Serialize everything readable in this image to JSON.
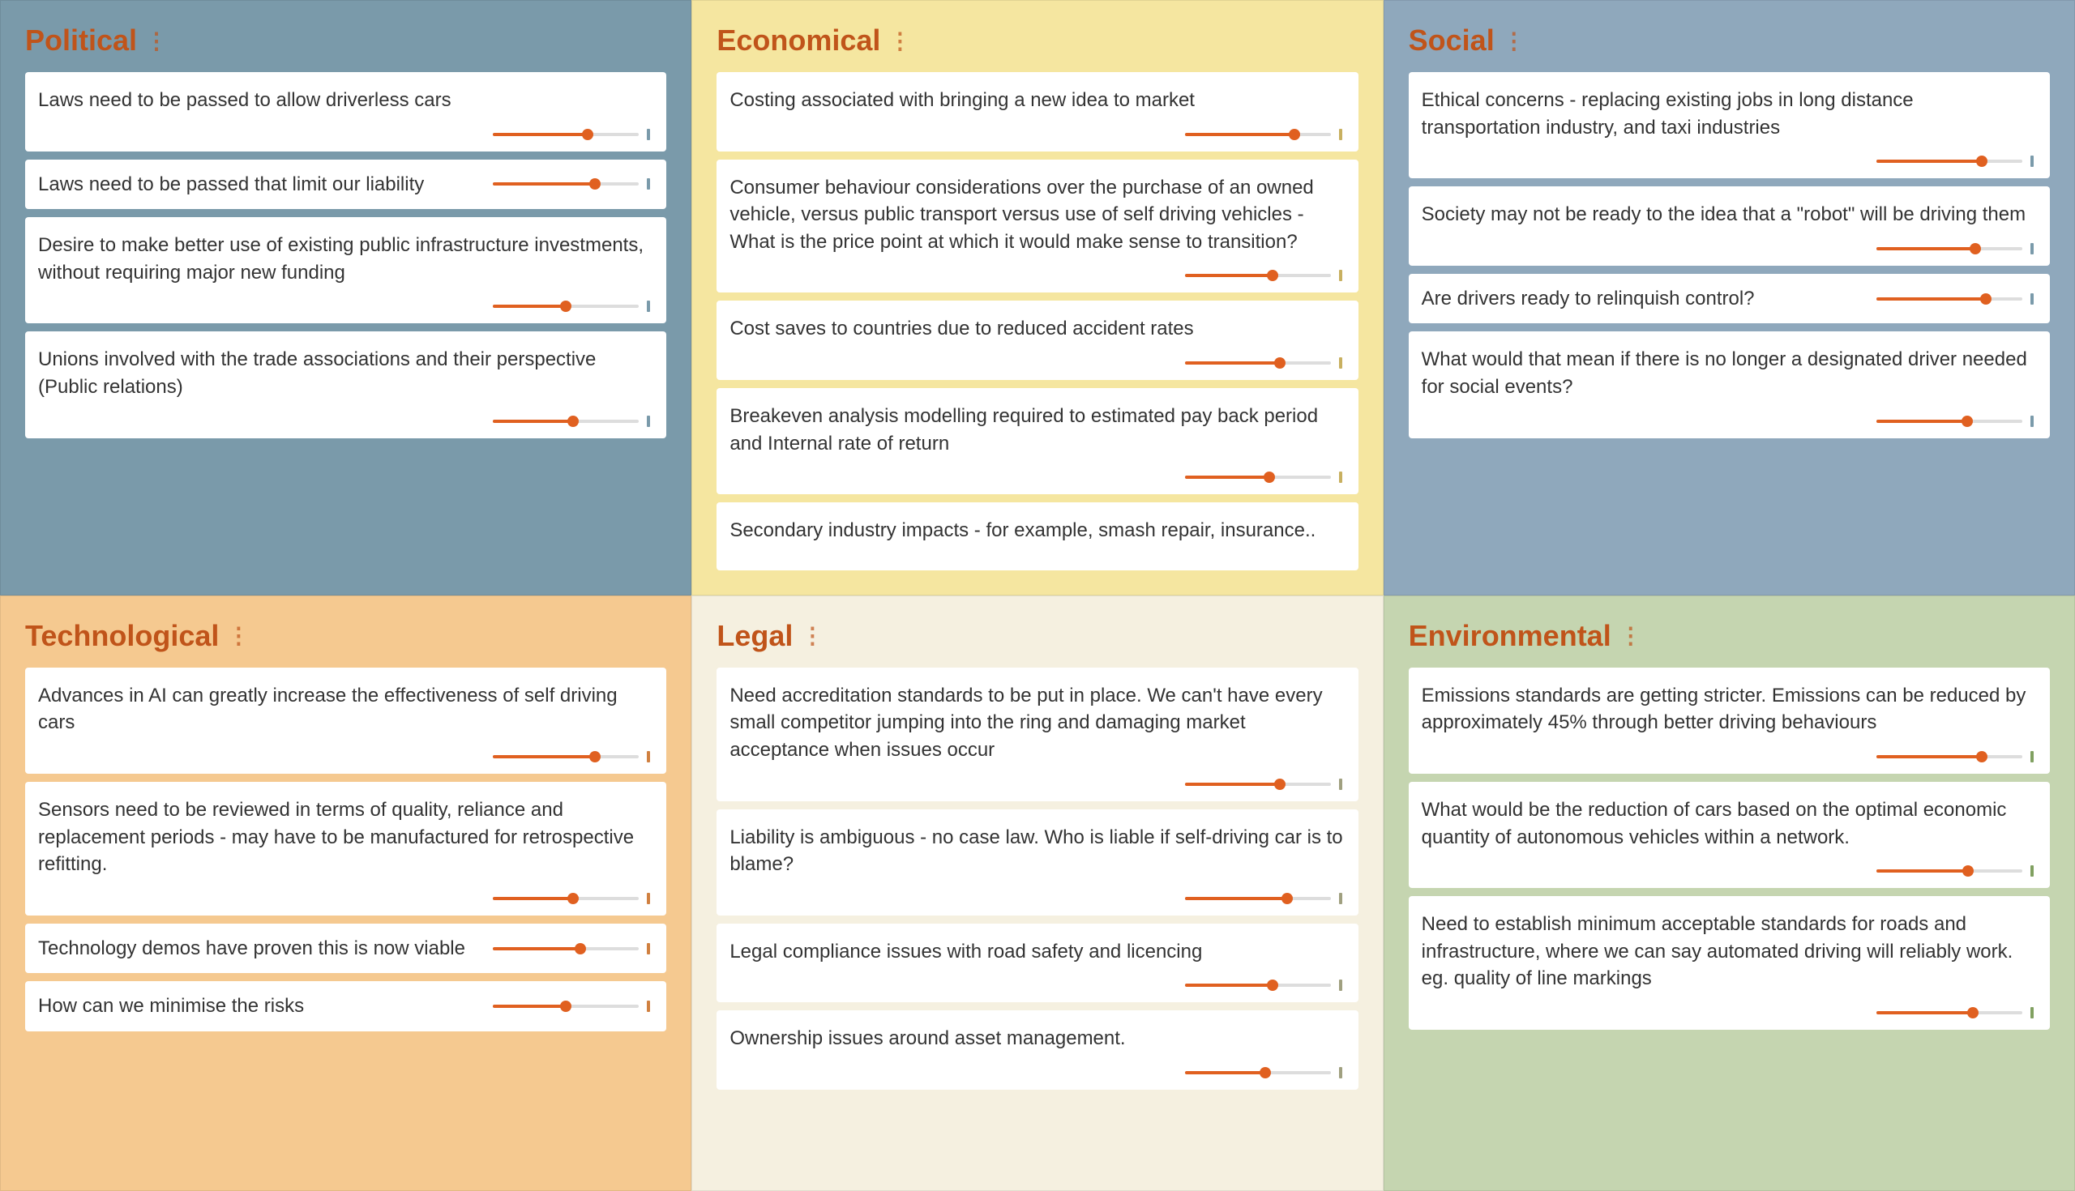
{
  "sections": [
    {
      "id": "political",
      "title": "Political",
      "colorClass": "section-political",
      "cards": [
        {
          "text": "Laws need to be passed to allow driverless cars",
          "sliderFill": 65,
          "inline": false
        },
        {
          "text": "Laws need to be passed that limit our liability",
          "sliderFill": 70,
          "inline": true
        },
        {
          "text": "Desire to make better use of existing public infrastructure investments, without requiring major new funding",
          "sliderFill": 50,
          "inline": false
        },
        {
          "text": "Unions involved with the trade associations and their perspective (Public relations)",
          "sliderFill": 55,
          "inline": false
        }
      ]
    },
    {
      "id": "economical",
      "title": "Economical",
      "colorClass": "section-economical",
      "cards": [
        {
          "text": "Costing associated with bringing a new idea to market",
          "sliderFill": 75,
          "inline": false
        },
        {
          "text": "Consumer behaviour considerations over the purchase of an owned vehicle, versus public transport versus use of self driving vehicles - What is the price point at which it would make sense to transition?",
          "sliderFill": 60,
          "inline": false
        },
        {
          "text": "Cost saves to countries due to reduced accident rates",
          "sliderFill": 65,
          "inline": false
        },
        {
          "text": "Breakeven analysis modelling required to estimated pay back period and Internal rate of return",
          "sliderFill": 58,
          "inline": false
        },
        {
          "text": "Secondary industry impacts - for example, smash repair, insurance..",
          "sliderFill": 0,
          "inline": false,
          "noSlider": true
        }
      ]
    },
    {
      "id": "social",
      "title": "Social",
      "colorClass": "section-social",
      "cards": [
        {
          "text": "Ethical concerns - replacing existing jobs in long distance transportation industry, and taxi industries",
          "sliderFill": 72,
          "inline": false
        },
        {
          "text": "Society may not be ready to the idea that a \"robot\" will be driving them",
          "sliderFill": 68,
          "inline": false
        },
        {
          "text": "Are drivers ready to relinquish control?",
          "sliderFill": 75,
          "inline": true
        },
        {
          "text": "What would that mean if there is no longer a designated driver needed for social events?",
          "sliderFill": 62,
          "inline": false
        }
      ]
    },
    {
      "id": "technological",
      "title": "Technological",
      "colorClass": "section-technological",
      "cards": [
        {
          "text": "Advances in AI can greatly increase the effectiveness of self driving cars",
          "sliderFill": 70,
          "inline": false
        },
        {
          "text": "Sensors need to be reviewed in terms of quality, reliance and replacement periods - may have to be manufactured for retrospective refitting.",
          "sliderFill": 55,
          "inline": false
        },
        {
          "text": "Technology demos have proven this is now viable",
          "sliderFill": 60,
          "inline": true
        },
        {
          "text": "How can we minimise the risks",
          "sliderFill": 50,
          "inline": true
        }
      ]
    },
    {
      "id": "legal",
      "title": "Legal",
      "colorClass": "section-legal",
      "cards": [
        {
          "text": "Need accreditation standards to be put in place. We can't have every small competitor jumping into the ring and damaging market acceptance when issues occur",
          "sliderFill": 65,
          "inline": false
        },
        {
          "text": "Liability is ambiguous - no case law. Who is liable if self-driving car is to blame?",
          "sliderFill": 70,
          "inline": false
        },
        {
          "text": "Legal compliance issues with road safety and licencing",
          "sliderFill": 60,
          "inline": false
        },
        {
          "text": "Ownership issues around asset management.",
          "sliderFill": 55,
          "inline": false
        }
      ]
    },
    {
      "id": "environmental",
      "title": "Environmental",
      "colorClass": "section-environmental",
      "cards": [
        {
          "text": "Emissions standards are getting stricter. Emissions can be reduced by approximately 45% through better driving behaviours",
          "sliderFill": 72,
          "inline": false
        },
        {
          "text": "What would be the reduction of cars based on the optimal economic quantity of autonomous vehicles within a network.",
          "sliderFill": 63,
          "inline": false
        },
        {
          "text": "Need to establish minimum acceptable standards for roads and infrastructure, where we can say automated driving will reliably work. eg. quality of line markings",
          "sliderFill": 66,
          "inline": false
        }
      ]
    }
  ],
  "dots_label": "⋮"
}
